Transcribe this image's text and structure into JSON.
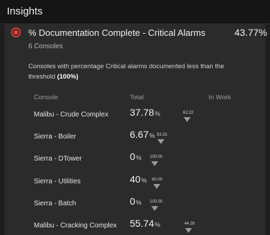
{
  "header": {
    "title": "Insights"
  },
  "card": {
    "title": "% Documentation Complete - Critical Alarms",
    "value": "43.77%",
    "subtitle": "6 Consoles",
    "description": "Consoles with percentage Critical alarms documented less than the threshold",
    "threshold": "(100%)",
    "alarm_color": "#ff3b30"
  },
  "table": {
    "columns": [
      "Console",
      "Total",
      "In Work"
    ],
    "rows": [
      {
        "console": "Malibu - Crude Complex",
        "total": "37.78",
        "unit": "%",
        "threshold": "62.22"
      },
      {
        "console": "Sierra - Boiler",
        "total": "6.67",
        "unit": "%",
        "threshold": "93.33"
      },
      {
        "console": "Sierra - DTower",
        "total": "0",
        "unit": "%",
        "threshold": "100.00"
      },
      {
        "console": "Sierra - Utilities",
        "total": "40",
        "unit": "%",
        "threshold": "60.00"
      },
      {
        "console": "Sierra - Batch",
        "total": "0",
        "unit": "%",
        "threshold": "100.00"
      },
      {
        "console": "Malibu - Cracking Complex",
        "total": "55.74",
        "unit": "%",
        "threshold": "44.26"
      }
    ]
  }
}
